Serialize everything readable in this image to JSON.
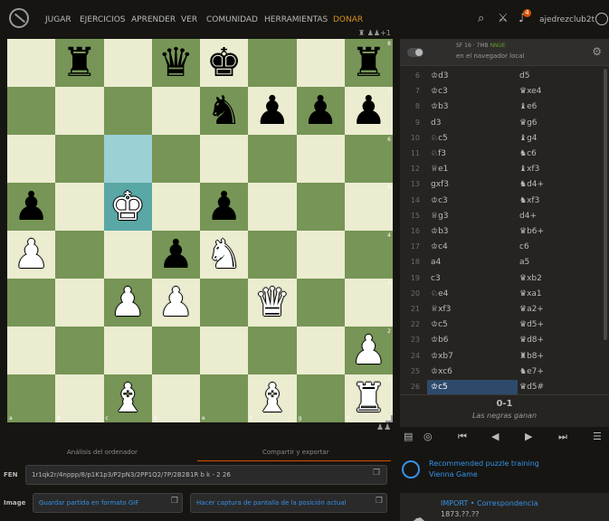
{
  "nav": {
    "items": [
      "JUGAR",
      "EJERCICIOS",
      "APRENDER",
      "VER",
      "COMUNIDAD",
      "HERRAMIENTAS",
      "DONAR"
    ],
    "notifications": "4",
    "username": "ajedrezclub2t",
    "mini_status": "+1"
  },
  "board": {
    "highlight_from": "c6",
    "highlight_to": "c5",
    "ranks": [
      "8",
      "7",
      "6",
      "5",
      "4",
      "3",
      "2",
      "1"
    ],
    "files": [
      "a",
      "b",
      "c",
      "d",
      "e",
      "f",
      "g",
      "h"
    ],
    "pieces": {
      "b8": "bR",
      "d8": "bQ",
      "e8": "bK",
      "h8": "bR",
      "e7": "bN",
      "f7": "bP",
      "g7": "bP",
      "h7": "bP",
      "a5": "bP",
      "c5": "wK",
      "e5": "bP",
      "a4": "wP",
      "d4": "bP",
      "e4": "wN",
      "c3": "wP",
      "d3": "wP",
      "f3": "wQ",
      "h2": "wP",
      "c1": "wB",
      "f1": "wB",
      "h1": "wR"
    }
  },
  "engine": {
    "name": "SF 16 · 7MB",
    "nnue": "NNUE",
    "sub": "en el navegador local"
  },
  "moves": [
    {
      "n": "6",
      "w": "♔d3",
      "b": "d5"
    },
    {
      "n": "7",
      "w": "♔c3",
      "b": "♛xe4"
    },
    {
      "n": "8",
      "w": "♔b3",
      "b": "♝e6"
    },
    {
      "n": "9",
      "w": "d3",
      "b": "♛g6"
    },
    {
      "n": "10",
      "w": "♘c5",
      "b": "♝g4"
    },
    {
      "n": "11",
      "w": "♘f3",
      "b": "♞c6"
    },
    {
      "n": "12",
      "w": "♕e1",
      "b": "♝xf3"
    },
    {
      "n": "13",
      "w": "gxf3",
      "b": "♞d4+"
    },
    {
      "n": "14",
      "w": "♔c3",
      "b": "♞xf3"
    },
    {
      "n": "15",
      "w": "♕g3",
      "b": "d4+"
    },
    {
      "n": "16",
      "w": "♔b3",
      "b": "♛b6+"
    },
    {
      "n": "17",
      "w": "♔c4",
      "b": "c6"
    },
    {
      "n": "18",
      "w": "a4",
      "b": "a5"
    },
    {
      "n": "19",
      "w": "c3",
      "b": "♛xb2"
    },
    {
      "n": "20",
      "w": "♘e4",
      "b": "♛xa1"
    },
    {
      "n": "21",
      "w": "♕xf3",
      "b": "♛a2+"
    },
    {
      "n": "22",
      "w": "♔c5",
      "b": "♛d5+"
    },
    {
      "n": "23",
      "w": "♔b6",
      "b": "♛d8+"
    },
    {
      "n": "24",
      "w": "♔xb7",
      "b": "♜b8+"
    },
    {
      "n": "25",
      "w": "♔xc6",
      "b": "♞e7+"
    },
    {
      "n": "26",
      "w": "♔c5",
      "b": "♛d5#"
    }
  ],
  "result": {
    "score": "0-1",
    "text": "Las negras ganan"
  },
  "tabs": {
    "analysis": "Análisis del ordenador",
    "share": "Compartir y exportar"
  },
  "fen": {
    "label": "FEN",
    "value": "1r1qk2r/4nppp/8/p1K1p3/P2pN3/2PP1Q2/7P/2B2B1R b k - 2 26"
  },
  "image": {
    "label": "Image",
    "gif": "Guardar partida en formato GIF",
    "screenshot": "Hacer captura de pantalla de la posición actual"
  },
  "puzzle": {
    "line1": "Recommended puzzle training",
    "line2": "Vienna Game"
  },
  "game": {
    "line1": "IMPORT • Correspondencia",
    "line2": "1873.??.??"
  },
  "colors": {
    "light_square": "#ebecd0",
    "dark_square": "#779556",
    "highlight_from": "#9bd0d4",
    "highlight_to": "#5aa8a6",
    "accent": "#d85000",
    "link": "#3692e7"
  }
}
